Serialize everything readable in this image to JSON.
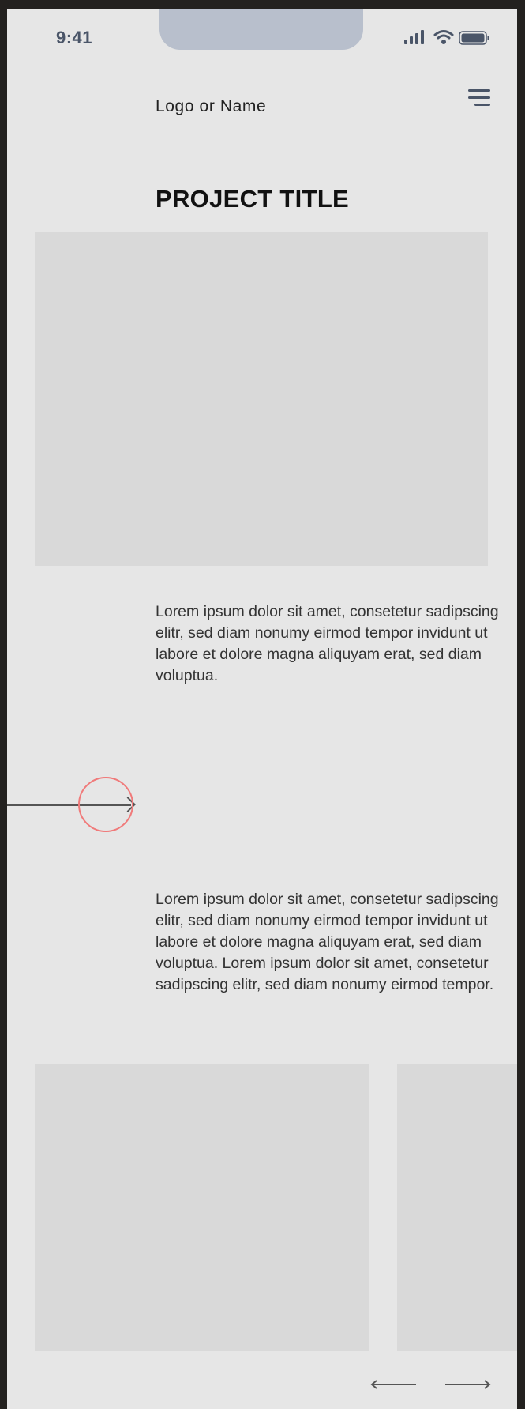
{
  "status_bar": {
    "time": "9:41"
  },
  "header": {
    "logo_text": "Logo or Name",
    "menu_icon": "hamburger-menu-icon"
  },
  "main": {
    "title": "PROJECT TITLE",
    "paragraph_1": "Lorem ipsum dolor sit amet, consetetur sadipscing elitr, sed diam nonumy eirmod tempor invidunt ut labore et dolore magna aliquyam erat, sed diam voluptua.",
    "paragraph_2": "Lorem ipsum dolor sit amet, consetetur sadipscing elitr, sed diam nonumy eirmod tempor invidunt ut labore et dolore magna aliquyam erat, sed diam voluptua. Lorem ipsum dolor sit amet, consetetur sadipscing elitr, sed diam nonumy eirmod tempor."
  },
  "gallery": {
    "prev_icon": "arrow-left-icon",
    "next_icon": "arrow-right-icon"
  },
  "colors": {
    "page_background": "#e6e6e6",
    "placeholder": "#d9d9d9",
    "notch": "#b8bfcc",
    "status_icons": "#4a5568",
    "hotspot_ring": "#f07a7a",
    "outer_background": "#23211f"
  }
}
